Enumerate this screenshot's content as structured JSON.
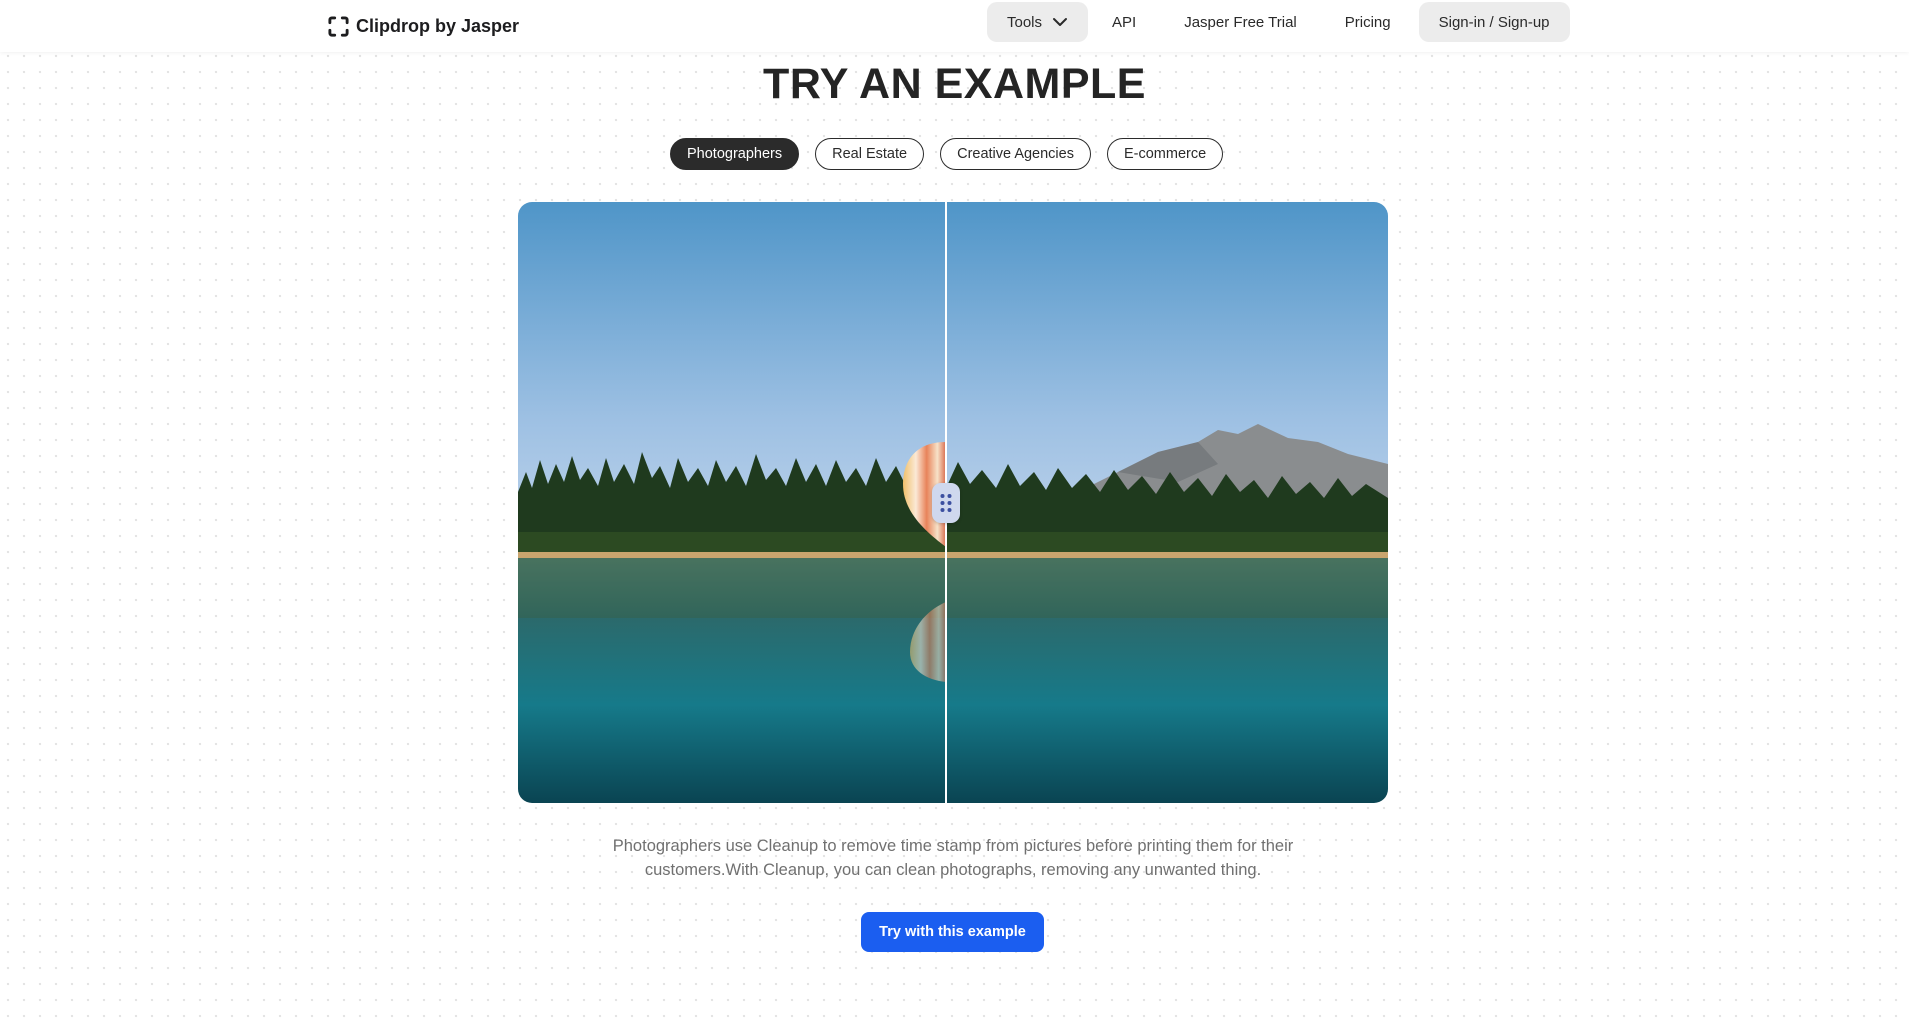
{
  "header": {
    "brand": "Clipdrop by Jasper",
    "nav": {
      "tools": "Tools",
      "api": "API",
      "trial": "Jasper Free Trial",
      "pricing": "Pricing",
      "signin": "Sign-in / Sign-up"
    }
  },
  "main": {
    "title": "TRY AN EXAMPLE",
    "tabs": [
      {
        "label": "Photographers",
        "active": true
      },
      {
        "label": "Real Estate",
        "active": false
      },
      {
        "label": "Creative Agencies",
        "active": false
      },
      {
        "label": "E-commerce",
        "active": false
      }
    ],
    "compare": {
      "before": "lake scene with hot air balloon",
      "after": "lake scene with mountain, balloon removed",
      "handle_icon": "drag-handle-icon"
    },
    "description": "Photographers use Cleanup to remove time stamp from pictures before printing them for their customers.With Cleanup, you can clean photographs, removing any unwanted thing.",
    "cta": "Try with this example"
  },
  "colors": {
    "accent": "#1b5ef0",
    "active_tab": "#2b2b2b",
    "nav_pill": "#ececec"
  }
}
